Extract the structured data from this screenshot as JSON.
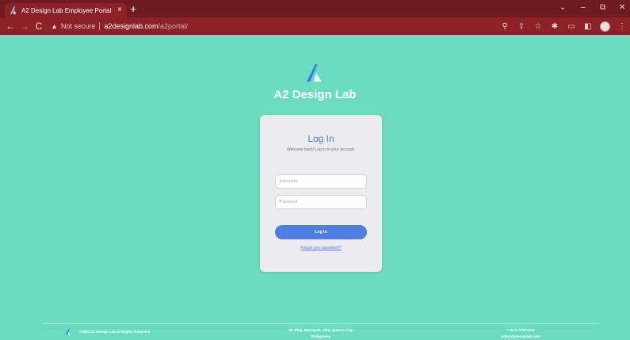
{
  "browser": {
    "tab_title": "A2 Design Lab Employee Portal",
    "tab_close": "×",
    "new_tab": "+",
    "not_secure": "Not secure",
    "url_host": "a2designlab.com",
    "url_path": "/a2portal/",
    "accent_color": "#8a2228",
    "icons": [
      "back-icon",
      "forward-icon",
      "reload-icon",
      "warning-icon",
      "zoom-icon",
      "share-icon",
      "star-icon",
      "extensions-icon",
      "cast-icon",
      "sidepanel-icon",
      "profile-avatar",
      "menu-icon"
    ]
  },
  "page": {
    "background_color": "#6cdcc0",
    "brand_name": "A2 Design Lab"
  },
  "login": {
    "title": "Log In",
    "subtitle": "Welcome back! Log in to your account.",
    "username_placeholder": "Username",
    "password_placeholder": "Password",
    "button_label": "Log In",
    "forgot_link": "Forgot your password?",
    "accent_color": "#4d7fe0"
  },
  "footer": {
    "copyright": "©2022 A2 Design Lab.All Rights Reserved",
    "address_line1": "4F, Bldg. Metropoli, Lbta, Quezon City,",
    "address_line2": "Philippines",
    "phone": "+ 63 2 7738'1101",
    "email": "info@a2designlab.com"
  }
}
